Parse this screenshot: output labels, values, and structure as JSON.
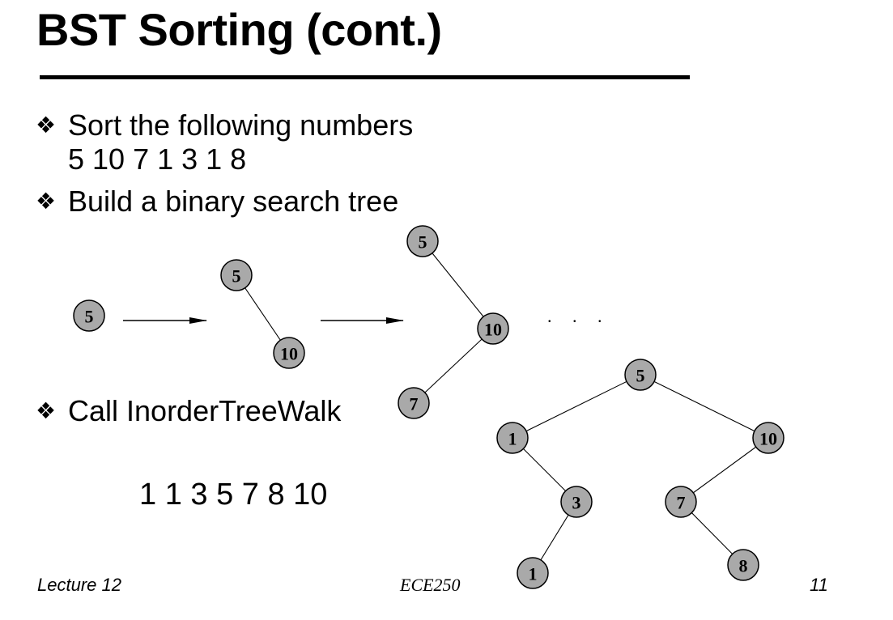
{
  "slide": {
    "title": "BST Sorting (cont.)",
    "bullets": [
      {
        "mark": "❖",
        "text": "Sort the following numbers",
        "subtext": "5 10 7 1 3 1 8"
      },
      {
        "mark": "❖",
        "text": "Build a binary search tree"
      },
      {
        "mark": "❖",
        "text": "Call InorderTreeWalk"
      }
    ],
    "sorted_output": "1 1 3 5 7 8 10",
    "ellipsis": ". . .",
    "footer": {
      "left": "Lecture 12",
      "center": "ECE250",
      "right": "11"
    }
  },
  "trees": {
    "node_color": "#a9a9a9",
    "step1": [
      "5"
    ],
    "step2": [
      "5",
      "10"
    ],
    "step3": [
      "5",
      "10",
      "7"
    ],
    "final": [
      "5",
      "1",
      "10",
      "3",
      "7",
      "1",
      "8"
    ]
  }
}
